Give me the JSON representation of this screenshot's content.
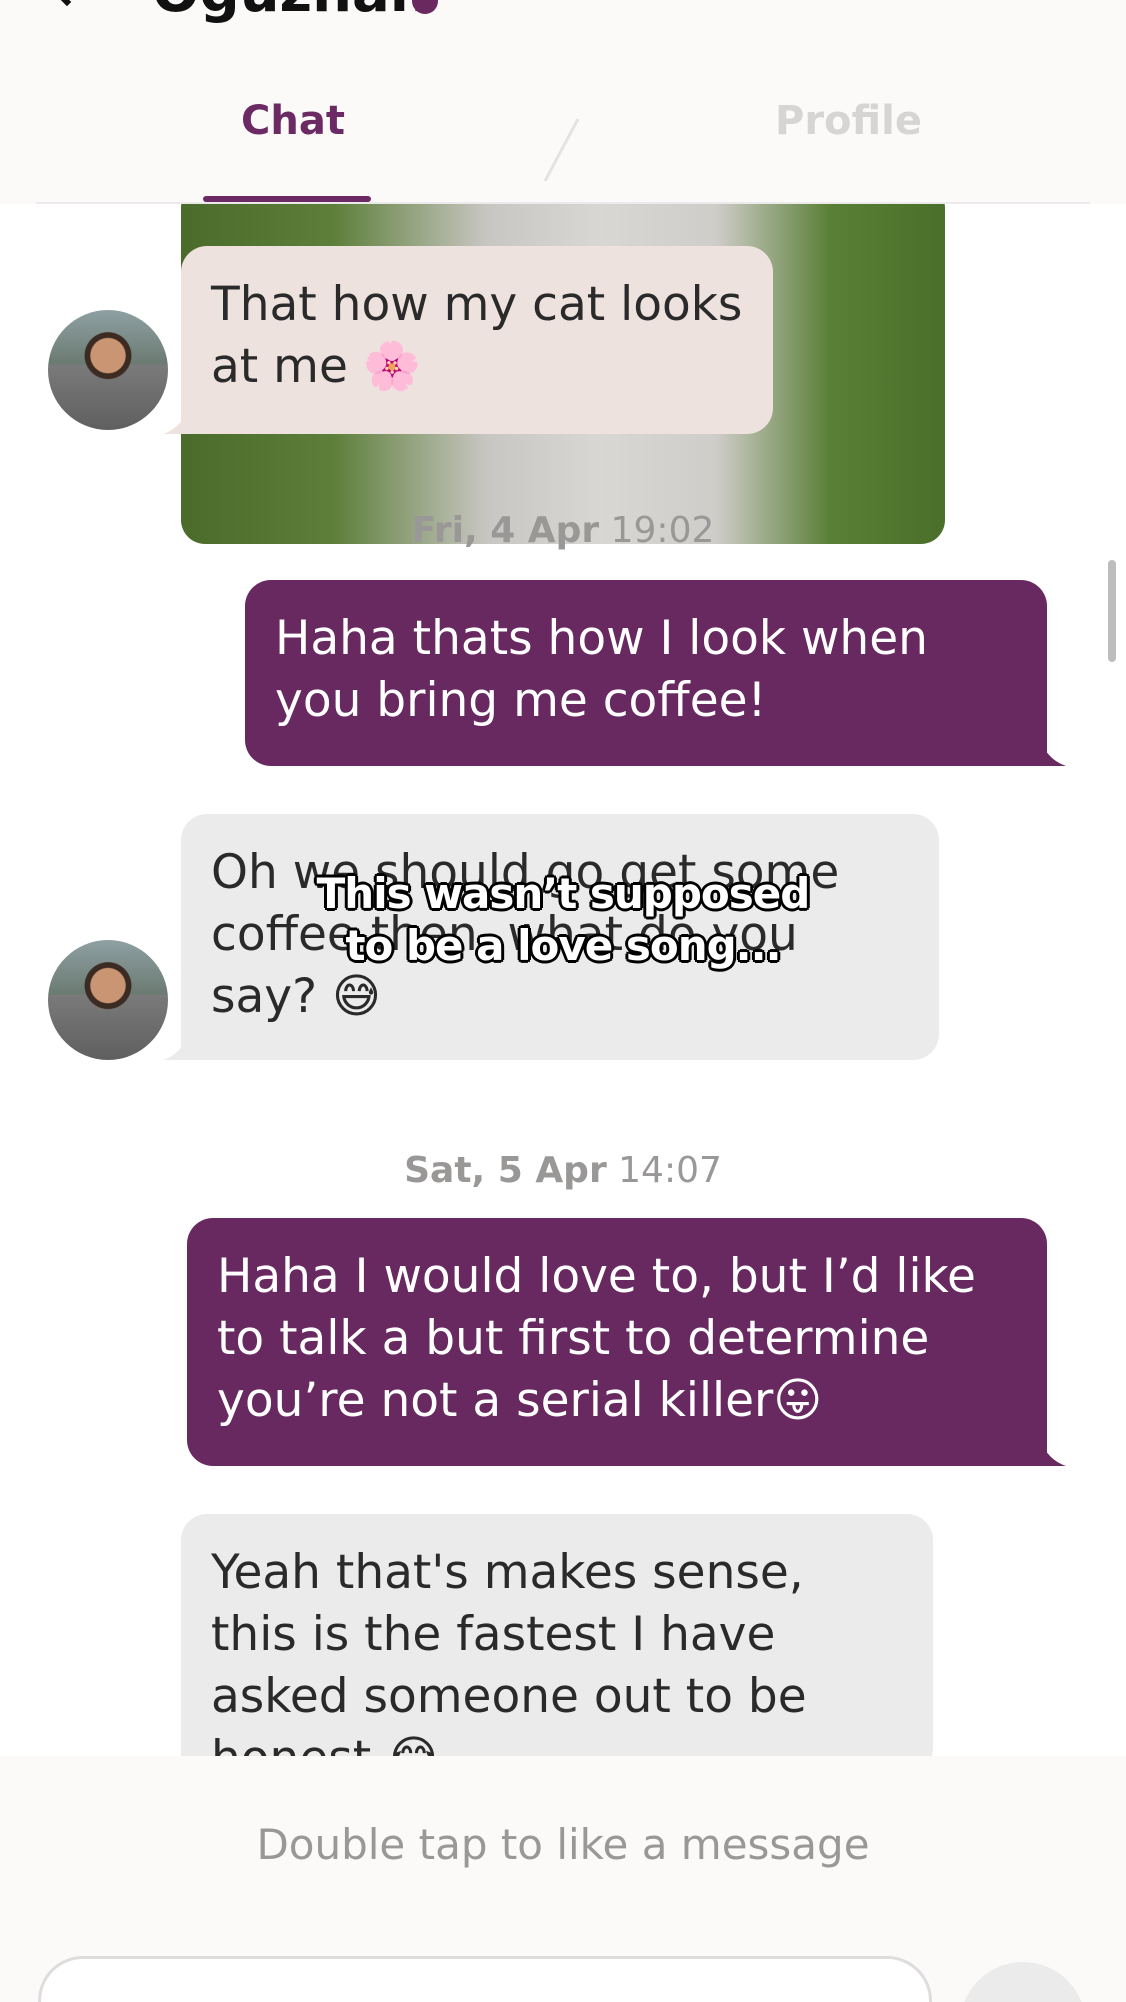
{
  "header": {
    "name": "Oguzhan",
    "tabs": [
      {
        "label": "Chat",
        "active": true
      },
      {
        "label": "Profile",
        "active": false
      }
    ]
  },
  "messages": [
    {
      "from": "match",
      "text": "That how my cat looks at me 🌸"
    },
    {
      "type": "timestamp",
      "date": "Fri, 4 Apr",
      "time": "19:02"
    },
    {
      "from": "me",
      "text": "Haha thats how I look when you bring me coffee!"
    },
    {
      "from": "match",
      "text": "Oh we should go get some coffee then, what do you say? 😅"
    },
    {
      "type": "timestamp",
      "date": "Sat, 5 Apr",
      "time": "14:07"
    },
    {
      "from": "me",
      "text": " Haha I would love to, but I’d like to talk a but first to determine you’re not a serial killer😛"
    },
    {
      "from": "match",
      "text": "Yeah that's makes sense, this is the fastest I have asked someone out to be honest 😂"
    }
  ],
  "overlay_caption": "This wasn’t supposed to be a love song...",
  "footer": {
    "hint": "Double tap to like a message"
  },
  "colors": {
    "accent": "#682961",
    "incoming_bubble": "#ecebeb",
    "incoming_bubble_tinted": "#eee2de"
  }
}
